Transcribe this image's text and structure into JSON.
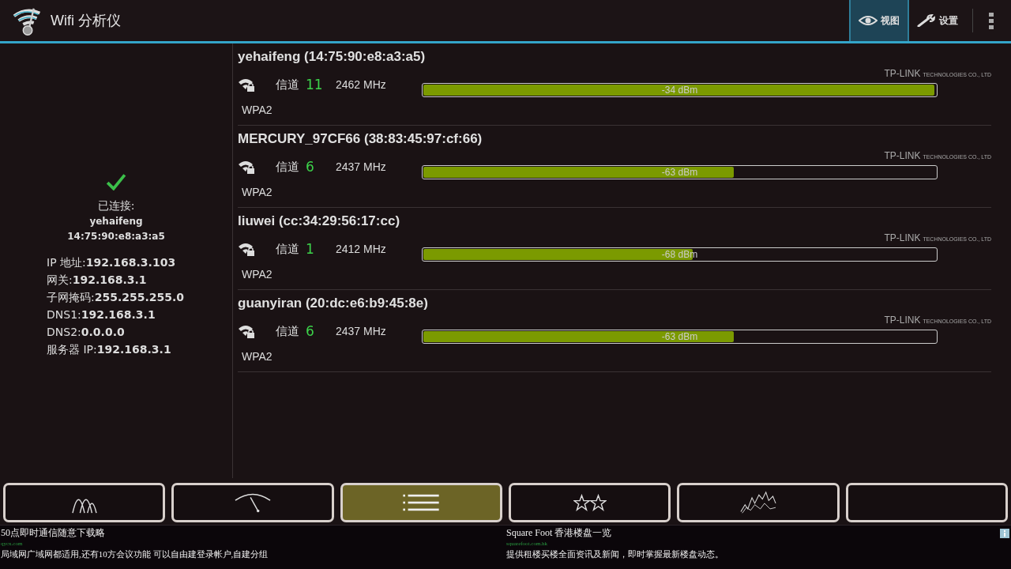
{
  "app_bar": {
    "title": "Wifi 分析仪",
    "actions": [
      {
        "kind": "eye",
        "label": "视图",
        "selected": true
      },
      {
        "kind": "wrench",
        "label": "设置",
        "selected": false
      }
    ]
  },
  "connection": {
    "status": "已连接:",
    "ssid": "yehaifeng",
    "bssid": "14:75:90:e8:a3:a5",
    "details": [
      {
        "label": "IP 地址:",
        "value": "192.168.3.103"
      },
      {
        "label": "网关:",
        "value": "192.168.3.1"
      },
      {
        "label": "子网掩码:",
        "value": "255.255.255.0"
      },
      {
        "label": "DNS1:",
        "value": "192.168.3.1"
      },
      {
        "label": "DNS2:",
        "value": "0.0.0.0"
      },
      {
        "label": "服务器 IP:",
        "value": "192.168.3.1"
      }
    ]
  },
  "networks": [
    {
      "name": "yehaifeng (14:75:90:e8:a3:a5)",
      "channel_label": "信道",
      "channel": "11",
      "frequency": "2462 MHz",
      "vendor": "TP-LINK",
      "vendor_suffix": "TECHNOLOGIES CO., LTD",
      "security": "WPA2",
      "level": 1.0,
      "reading": "-34 dBm"
    },
    {
      "name": "MERCURY_97CF66 (38:83:45:97:cf:66)",
      "channel_label": "信道",
      "channel": "6",
      "frequency": "2437 MHz",
      "vendor": "TP-LINK",
      "vendor_suffix": "TECHNOLOGIES CO., LTD",
      "security": "WPA2",
      "level": 0.61,
      "reading": "-63 dBm"
    },
    {
      "name": "liuwei (cc:34:29:56:17:cc)",
      "channel_label": "信道",
      "channel": "1",
      "frequency": "2412 MHz",
      "vendor": "TP-LINK",
      "vendor_suffix": "TECHNOLOGIES CO., LTD",
      "security": "WPA2",
      "level": 0.53,
      "reading": "-68 dBm"
    },
    {
      "name": "guanyiran (20:dc:e6:b9:45:8e)",
      "channel_label": "信道",
      "channel": "6",
      "frequency": "2437 MHz",
      "vendor": "TP-LINK",
      "vendor_suffix": "TECHNOLOGIES CO., LTD",
      "security": "WPA2",
      "level": 0.61,
      "reading": "-63 dBm"
    }
  ],
  "tabs": [
    {
      "kind": "peaks",
      "selected": false
    },
    {
      "kind": "gauge",
      "selected": false
    },
    {
      "kind": "list",
      "selected": true
    },
    {
      "kind": "stars",
      "selected": false
    },
    {
      "kind": "graph",
      "selected": false
    },
    {
      "kind": "blank",
      "selected": false
    }
  ],
  "ads": [
    {
      "title": "50点即时通信随意下载略",
      "url": "qycx.com",
      "text": "局域网广域网都适用,还有10方会议功能 可以自由建登录帐户,自建分组"
    },
    {
      "title": "Square Foot 香港楼盘一览",
      "url": "squarefoot.com.hk",
      "text": "提供租楼买楼全面资讯及新闻，即时掌握最新楼盘动态。"
    }
  ]
}
